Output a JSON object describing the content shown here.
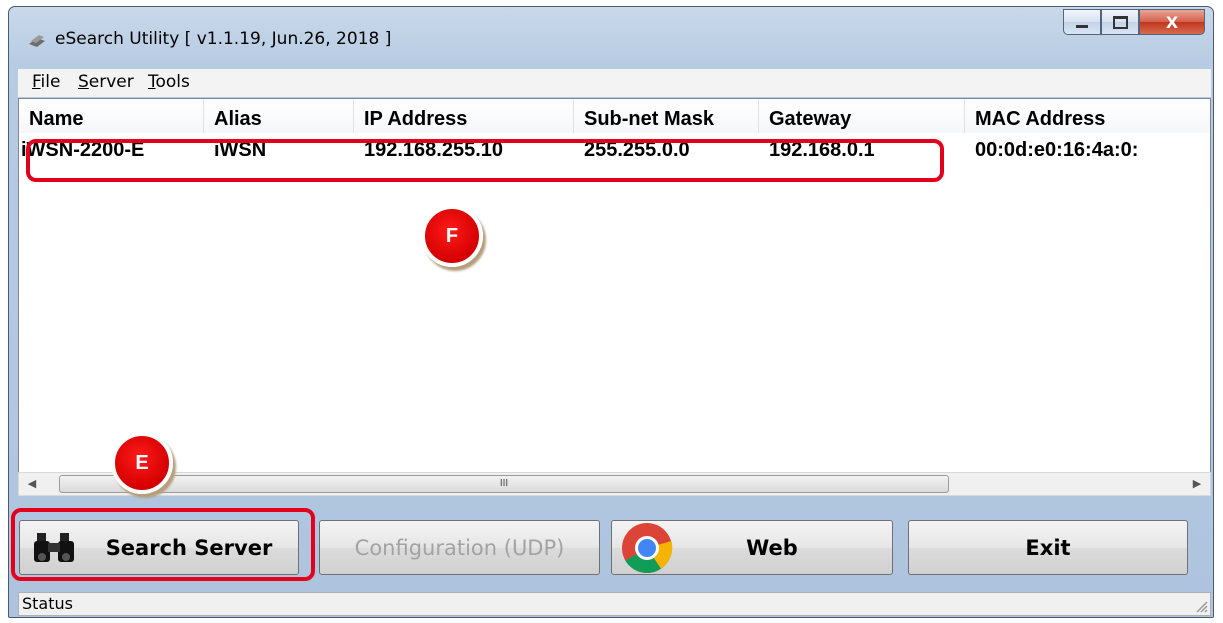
{
  "window": {
    "title": "eSearch Utility [ v1.1.19, Jun.26, 2018 ]",
    "close_glyph": "X"
  },
  "menu": [
    "File",
    "Server",
    "Tools"
  ],
  "table": {
    "columns": [
      "Name",
      "Alias",
      "IP Address",
      "Sub-net Mask",
      "Gateway",
      "MAC Address"
    ],
    "rows": [
      [
        "iWSN-2200-E",
        "iWSN",
        "192.168.255.10",
        "255.255.0.0",
        "192.168.0.1",
        "00:0d:e0:16:4a:0:"
      ]
    ]
  },
  "scrollbar": {
    "thumb_glyph": "III"
  },
  "buttons": {
    "search": "Search Server",
    "config": "Configuration (UDP)",
    "web": "Web",
    "exit": "Exit"
  },
  "status": {
    "text": "Status"
  },
  "markers": {
    "e": "E",
    "f": "F"
  },
  "colors": {
    "highlight": "#e3001b",
    "marker": "#d40000"
  },
  "icons": [
    "binoculars-icon",
    "chrome-icon",
    "app-icon"
  ]
}
